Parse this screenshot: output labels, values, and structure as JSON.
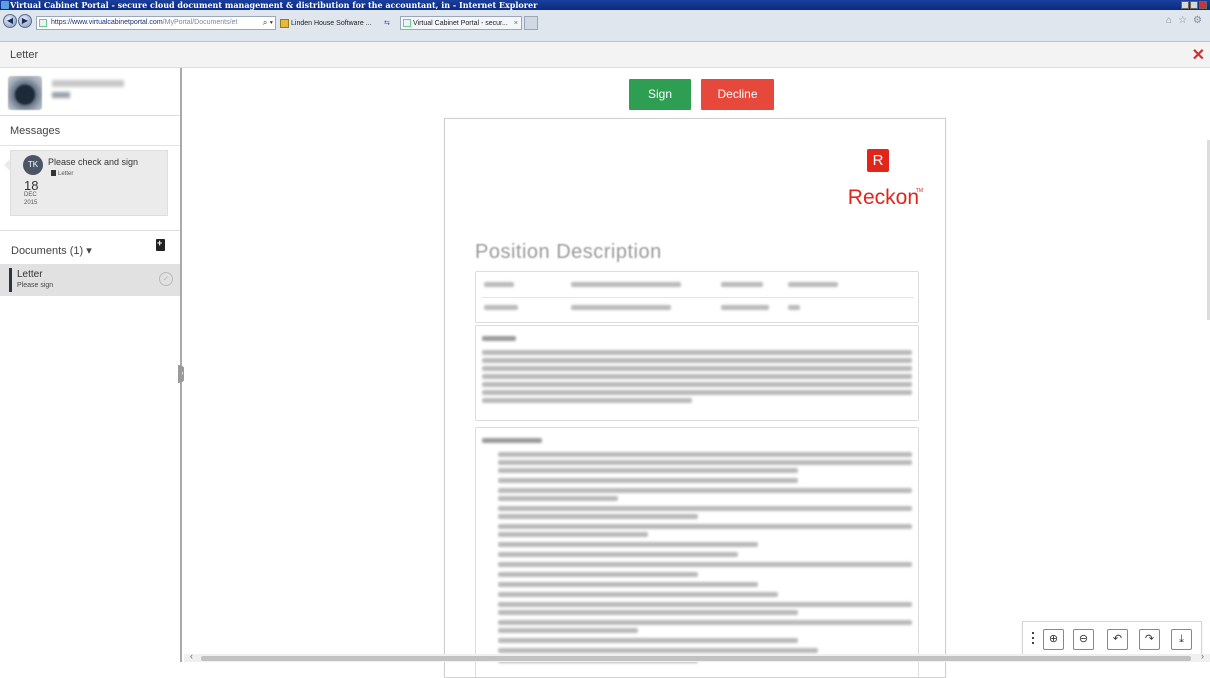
{
  "browser": {
    "window_title": "Virtual Cabinet Portal - secure cloud document management & distribution for the accountant, in - Internet Explorer",
    "address_url": "https://www.virtualcabinetportal.com",
    "address_url_rest": "/MyPortal/Documents/et",
    "address_tools": "⌕ ▾",
    "fav_tab": "Linden House Software ...",
    "tab_title": "Virtual Cabinet Portal - secur...",
    "tab_close": "×",
    "add_tab_glyph": "+",
    "right_icons": [
      "⌂",
      "☆",
      "⚙"
    ],
    "back_glyph": "◀",
    "forward_glyph": "▶"
  },
  "header": {
    "title": "Letter",
    "close_glyph": "✕"
  },
  "sidebar": {
    "messages_label": "Messages",
    "message": {
      "avatar_initials": "TK",
      "text": "Please check and sign",
      "attachment": "Letter",
      "day": "18",
      "month": "DEC",
      "year": "2015"
    },
    "documents_label": "Documents (1) ▾",
    "documents": [
      {
        "name": "Letter",
        "status": "Please sign"
      }
    ],
    "collapse_glyph": "›"
  },
  "actions": {
    "sign_label": "Sign",
    "decline_label": "Decline"
  },
  "document": {
    "logo_letter": "R",
    "logo_word": "Reckon",
    "logo_tm": "TM",
    "title": "Position Description"
  },
  "viewer_toolbar": {
    "zoom_in_glyph": "⊕",
    "zoom_out_glyph": "⊖",
    "rotate_left_glyph": "↶",
    "rotate_right_glyph": "↷",
    "download_glyph": "⤓"
  },
  "scroll": {
    "left_arrow": "‹",
    "right_arrow": "›"
  }
}
